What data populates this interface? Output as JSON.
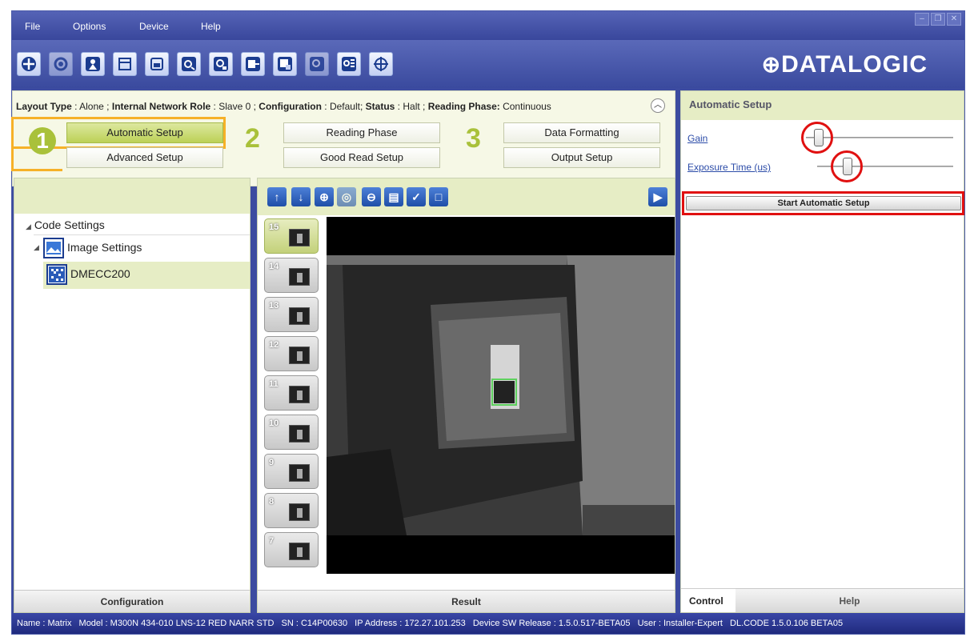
{
  "menu": {
    "file": "File",
    "options": "Options",
    "device": "Device",
    "help": "Help"
  },
  "logo": "DATALOGIC",
  "status_line": {
    "layout_label": "Layout Type",
    "layout_value": "Alone",
    "role_label": "Internal Network Role",
    "role_value": "Slave 0",
    "config_label": "Configuration",
    "config_value": "Default",
    "status_label": "Status",
    "status_value": "Halt",
    "phase_label": "Reading Phase:",
    "phase_value": "Continuous"
  },
  "steps": {
    "n1": "1",
    "n2": "2",
    "n3": "3",
    "automatic_setup": "Automatic Setup",
    "advanced_setup": "Advanced Setup",
    "reading_phase": "Reading Phase",
    "good_read_setup": "Good Read Setup",
    "data_formatting": "Data Formatting",
    "output_setup": "Output Setup"
  },
  "tree": {
    "code_settings": "Code Settings",
    "image_settings": "Image Settings",
    "dmecc200": "DMECC200"
  },
  "left_footer": "Configuration",
  "result_footer": "Result",
  "thumbnails": [
    "15",
    "14",
    "13",
    "12",
    "11",
    "10",
    "9",
    "8",
    "7"
  ],
  "automatic_setup": {
    "title": "Automatic Setup",
    "gain_label": "Gain",
    "exposure_label": "Exposure Time (us)",
    "start_button": "Start Automatic Setup"
  },
  "tabs": {
    "control": "Control",
    "help": "Help"
  },
  "statusbar": {
    "name": "Name : Matrix",
    "model": "Model : M300N 434-010 LNS-12 RED NARR STD",
    "sn": "SN : C14P00630",
    "ip": "IP Address : 172.27.101.253",
    "sw": "Device SW Release : 1.5.0.517-BETA05",
    "user": "User : Installer-Expert",
    "dlcode": "DL.CODE 1.5.0.106 BETA05"
  },
  "colors": {
    "accent_green": "#a9c13a",
    "highlight_orange": "#f6b128",
    "highlight_red": "#e01010",
    "frame_blue": "#3c4ba0"
  }
}
